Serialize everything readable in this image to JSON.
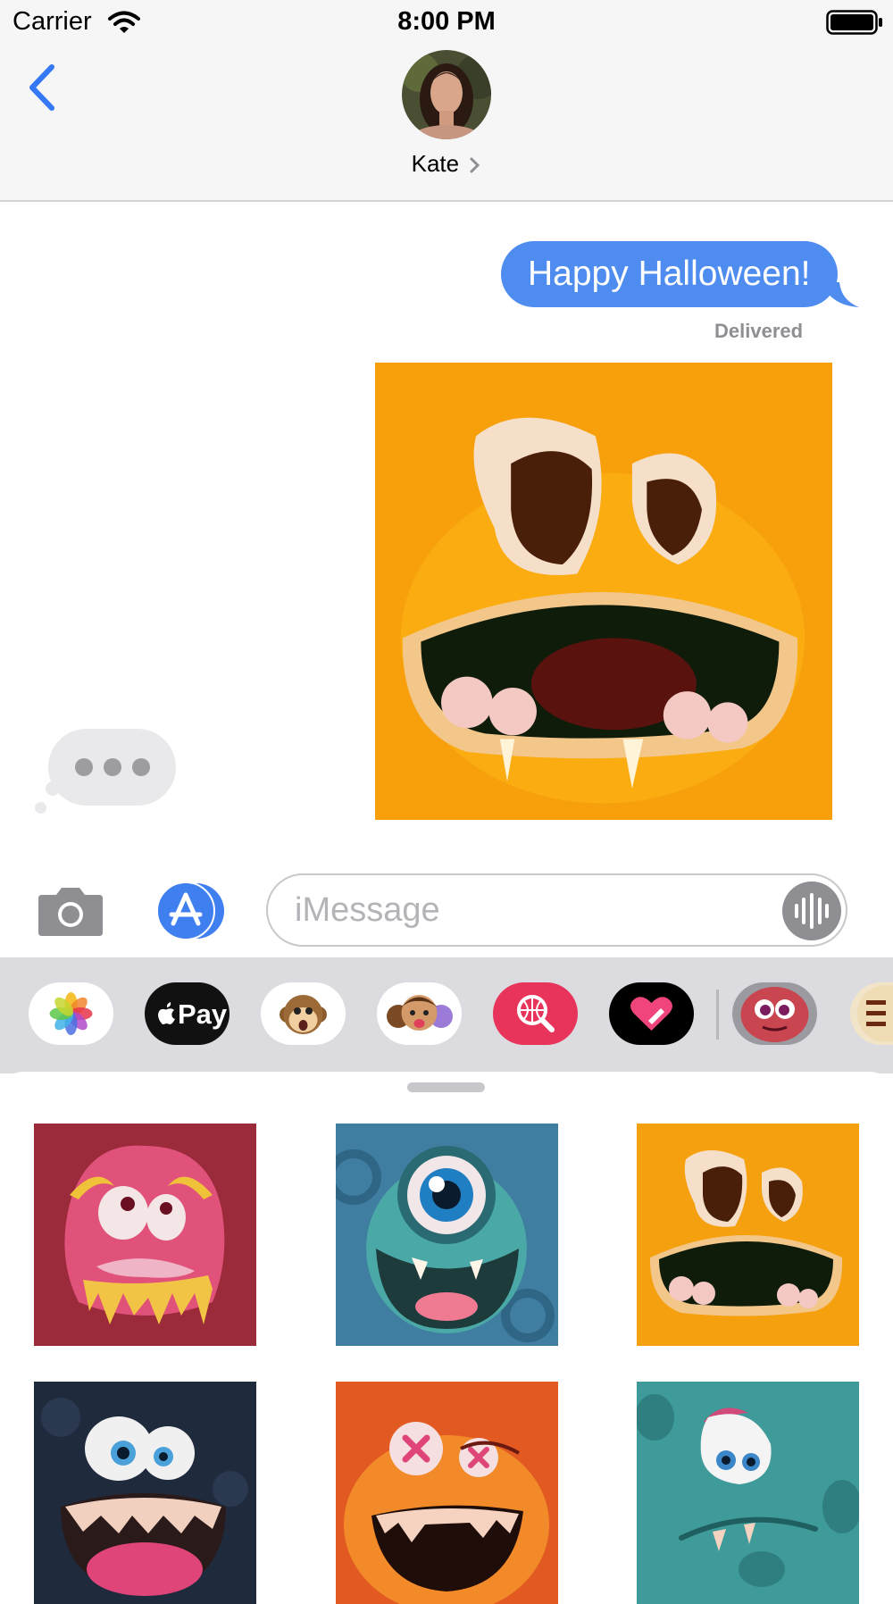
{
  "status_bar": {
    "carrier": "Carrier",
    "time": "8:00 PM"
  },
  "header": {
    "contact_name": "Kate",
    "back_icon": "chevron-left-icon"
  },
  "messages": {
    "sent_text": "Happy Halloween!",
    "status": "Delivered",
    "sticker": "orange-monster-sticker"
  },
  "input_bar": {
    "placeholder": "iMessage"
  },
  "apps": [
    {
      "name": "Photos",
      "icon": "photos-icon"
    },
    {
      "name": "Pay",
      "icon": "apple-pay-icon",
      "label": "Pay"
    },
    {
      "name": "Animoji",
      "icon": "monkey-icon"
    },
    {
      "name": "Memoji",
      "icon": "memoji-icon"
    },
    {
      "name": "Search",
      "icon": "web-search-icon"
    },
    {
      "name": "Digital Touch",
      "icon": "heart-icon"
    },
    {
      "name": "Monster Stickers",
      "icon": "monster-icon"
    },
    {
      "name": "Happy Halloween",
      "icon": "halloween-icon"
    }
  ],
  "stickers": [
    {
      "name": "pink-monster-sticker",
      "bg": "#9b2a3a"
    },
    {
      "name": "cyclops-monster-sticker",
      "bg": "#3f7ea1"
    },
    {
      "name": "orange-monster-sticker",
      "bg": "#f5a10f"
    },
    {
      "name": "navy-monster-sticker",
      "bg": "#1f2a3d"
    },
    {
      "name": "red-monster-sticker",
      "bg": "#e25a22"
    },
    {
      "name": "teal-monster-sticker",
      "bg": "#3f9a9a"
    }
  ],
  "colors": {
    "accent": "#4f8cf0",
    "bubble_gray": "#e9e9eb"
  }
}
